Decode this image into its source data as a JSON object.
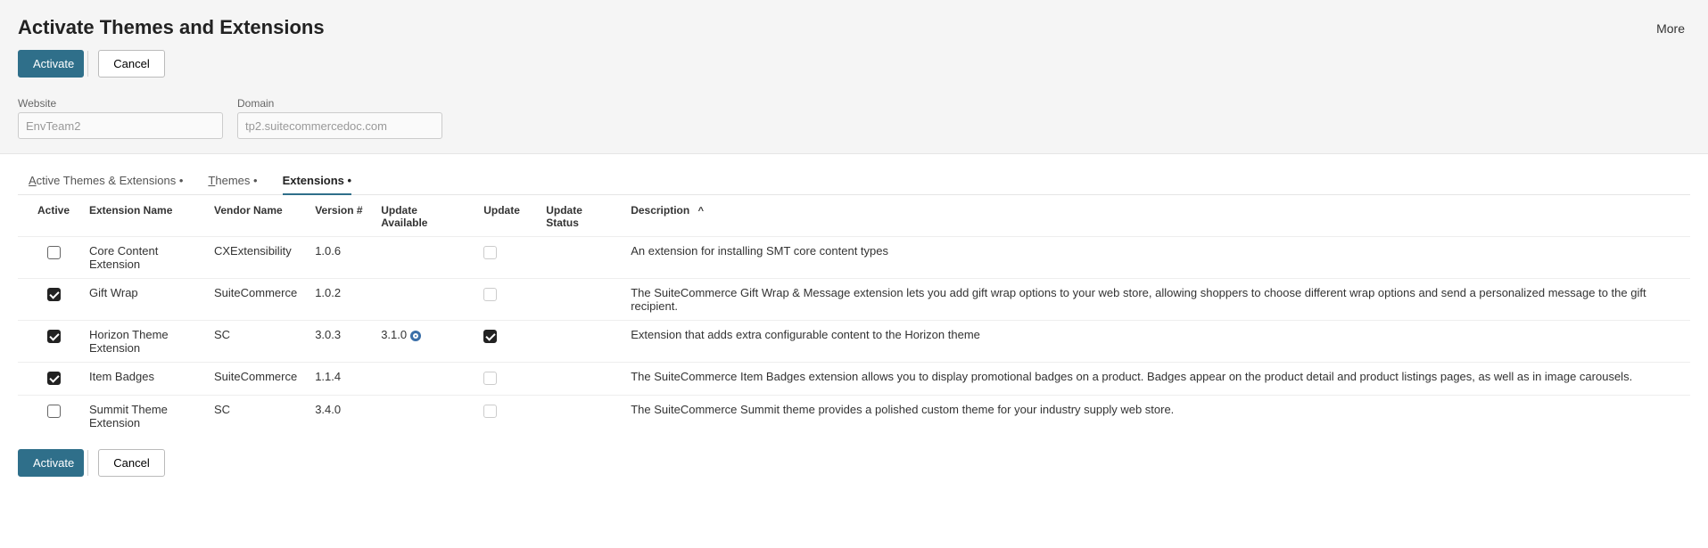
{
  "header": {
    "title": "Activate Themes and Extensions",
    "more_label": "More",
    "activate_label": "Activate",
    "cancel_label": "Cancel"
  },
  "fields": {
    "website": {
      "label": "Website",
      "value": "EnvTeam2"
    },
    "domain": {
      "label": "Domain",
      "value": "tp2.suitecommercedoc.com"
    }
  },
  "tabs": {
    "active_ext": "ctive Themes & Extensions",
    "active_ext_letter": "A",
    "themes": "hemes",
    "themes_letter": "T",
    "extensions": "Extensions",
    "suffix": " •"
  },
  "columns": {
    "active": "Active",
    "name": "Extension Name",
    "vendor": "Vendor Name",
    "version": "Version #",
    "update_available": "Update Available",
    "update": "Update",
    "update_status": "Update Status",
    "description": "Description"
  },
  "rows": [
    {
      "active": false,
      "name": "Core Content Extension",
      "vendor": "CXExtensibility",
      "version": "1.0.6",
      "update_available": "",
      "update": false,
      "update_disabled": true,
      "description": "An extension for installing SMT core content types"
    },
    {
      "active": true,
      "name": "Gift Wrap",
      "vendor": "SuiteCommerce",
      "version": "1.0.2",
      "update_available": "",
      "update": false,
      "update_disabled": true,
      "description": "The SuiteCommerce Gift Wrap & Message extension lets you add gift wrap options to your web store, allowing shoppers to choose different wrap options and send a personalized message to the gift recipient."
    },
    {
      "active": true,
      "name": "Horizon Theme Extension",
      "vendor": "SC",
      "version": "3.0.3",
      "update_available": "3.1.0",
      "update_icon": true,
      "update": true,
      "update_disabled": false,
      "description": "Extension that adds extra configurable content to the Horizon theme"
    },
    {
      "active": true,
      "name": "Item Badges",
      "vendor": "SuiteCommerce",
      "version": "1.1.4",
      "update_available": "",
      "update": false,
      "update_disabled": true,
      "description": "The SuiteCommerce Item Badges extension allows you to display promotional badges on a product. Badges appear on the product detail and product listings pages, as well as in image carousels."
    },
    {
      "active": false,
      "name": "Summit Theme Extension",
      "vendor": "SC",
      "version": "3.4.0",
      "update_available": "",
      "update": false,
      "update_disabled": true,
      "description": "The SuiteCommerce Summit theme provides a polished custom theme for your industry supply web store."
    }
  ],
  "footer": {
    "activate_label": "Activate",
    "cancel_label": "Cancel"
  }
}
